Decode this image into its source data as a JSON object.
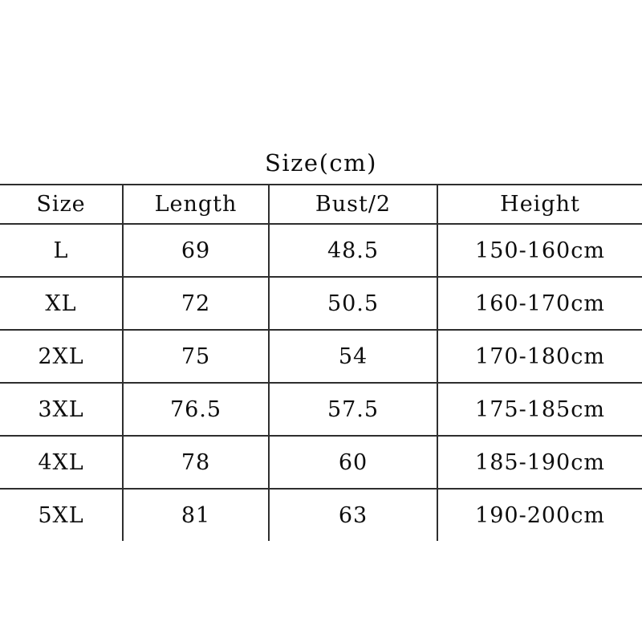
{
  "title": "Size(cm)",
  "colors": {
    "background": "#ffffff",
    "text": "#0d0d0d",
    "gridline": "#2e2e2e"
  },
  "chart_data": {
    "type": "table",
    "title": "Size(cm)",
    "xlabel": "",
    "ylabel": "",
    "grid": true,
    "legend": "none",
    "columns": [
      "Size",
      "Length",
      "Bust/2",
      "Height"
    ],
    "rows": [
      {
        "size": "L",
        "length": "69",
        "bust2": "48.5",
        "height": "150-160cm"
      },
      {
        "size": "XL",
        "length": "72",
        "bust2": "50.5",
        "height": "160-170cm"
      },
      {
        "size": "2XL",
        "length": "75",
        "bust2": "54",
        "height": "170-180cm"
      },
      {
        "size": "3XL",
        "length": "76.5",
        "bust2": "57.5",
        "height": "175-185cm"
      },
      {
        "size": "4XL",
        "length": "78",
        "bust2": "60",
        "height": "185-190cm"
      },
      {
        "size": "5XL",
        "length": "81",
        "bust2": "63",
        "height": "190-200cm"
      }
    ],
    "series": [
      {
        "name": "Length",
        "values": [
          69,
          72,
          75,
          76.5,
          78,
          81
        ]
      },
      {
        "name": "Bust/2",
        "values": [
          48.5,
          50.5,
          54,
          57.5,
          60,
          63
        ]
      }
    ],
    "categories": [
      "L",
      "XL",
      "2XL",
      "3XL",
      "4XL",
      "5XL"
    ],
    "units": "cm"
  }
}
